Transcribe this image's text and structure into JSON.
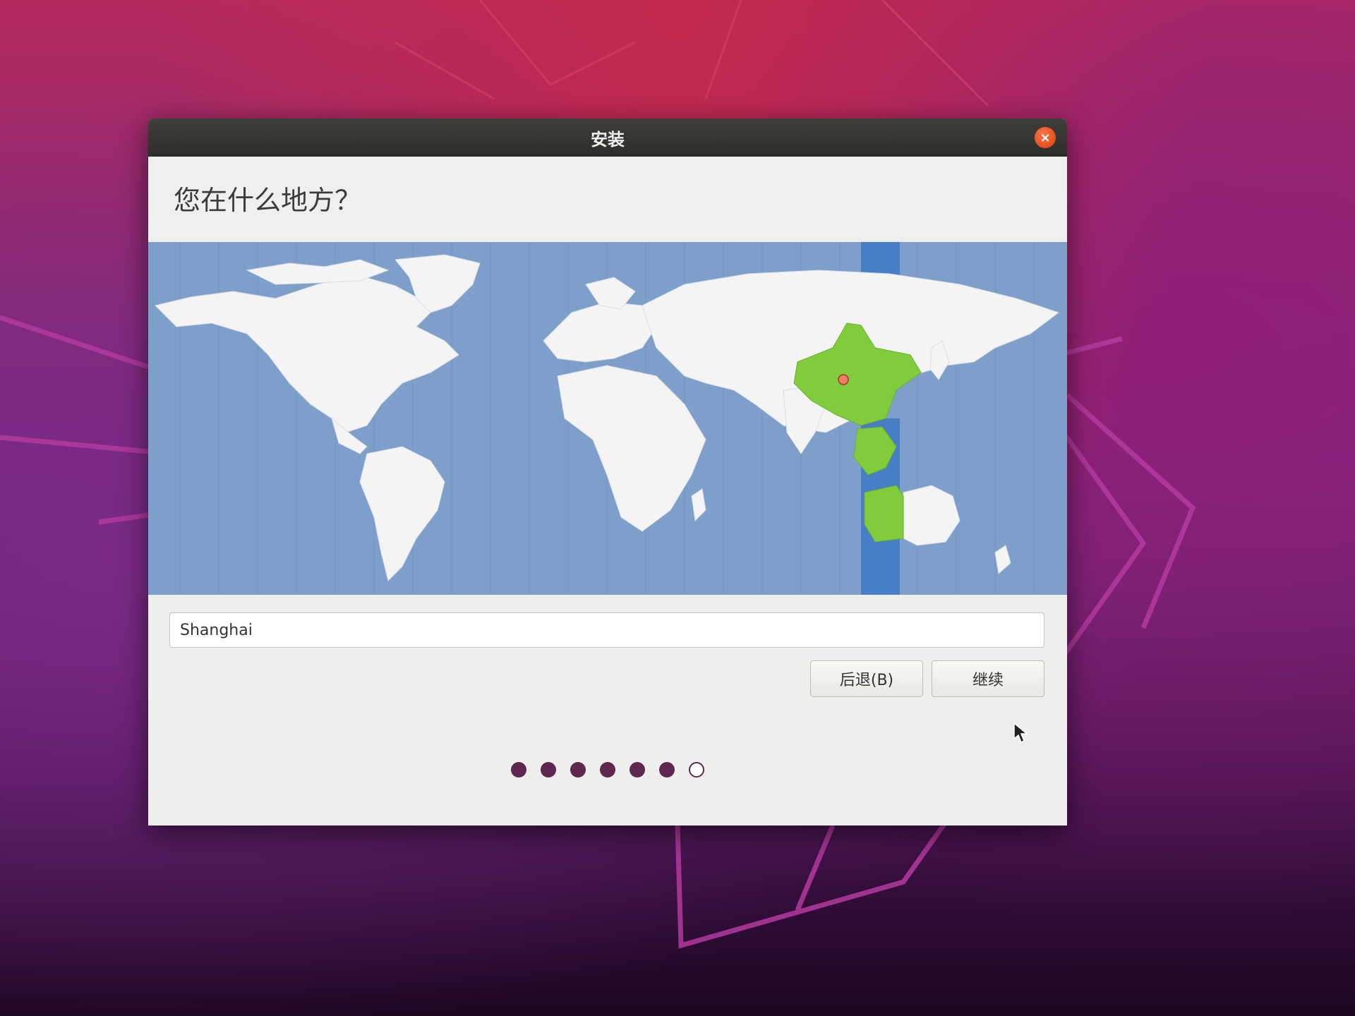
{
  "window": {
    "title": "安装",
    "close_icon": "×"
  },
  "page": {
    "title": "您在什么地方？"
  },
  "map": {
    "highlight_color": "#80cc3d",
    "ocean_color": "#7d9fc9",
    "land_color": "#f4f4f4",
    "timezone_band_color": "#3d78c4",
    "selected_marker_color": "#f28060"
  },
  "timezone": {
    "value": "Shanghai"
  },
  "buttons": {
    "back_label": "后退(B)",
    "continue_label": "继续"
  },
  "progress": {
    "total_steps": 7,
    "completed_steps": 6,
    "colors": {
      "done": "#5e2750"
    }
  }
}
